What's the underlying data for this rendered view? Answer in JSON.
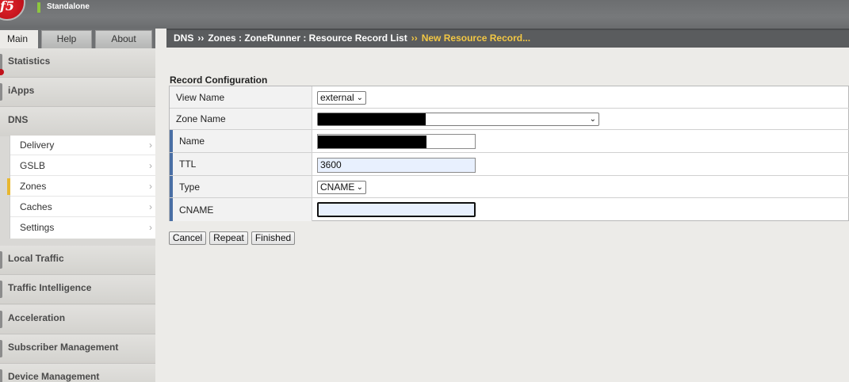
{
  "header": {
    "status": "Standalone",
    "logo_text": "f5"
  },
  "tabs": [
    {
      "label": "Main"
    },
    {
      "label": "Help"
    },
    {
      "label": "About"
    }
  ],
  "breadcrumb": {
    "items": [
      "DNS",
      "Zones : ZoneRunner : Resource Record List"
    ],
    "separator": "››",
    "current": "New Resource Record..."
  },
  "sidebar": {
    "sections": [
      {
        "label": "Statistics"
      },
      {
        "label": "iApps"
      },
      {
        "label": "DNS"
      },
      {
        "label": "Local Traffic"
      },
      {
        "label": "Traffic Intelligence"
      },
      {
        "label": "Acceleration"
      },
      {
        "label": "Subscriber Management"
      },
      {
        "label": "Device Management"
      }
    ],
    "dns_items": [
      {
        "label": "Delivery"
      },
      {
        "label": "GSLB"
      },
      {
        "label": "Zones",
        "selected": true
      },
      {
        "label": "Caches"
      },
      {
        "label": "Settings"
      }
    ],
    "chevron": "›"
  },
  "form": {
    "title": "Record Configuration",
    "rows": [
      {
        "label": "View Name",
        "value": "external"
      },
      {
        "label": "Zone Name",
        "value": ""
      },
      {
        "label": "Name",
        "value": ""
      },
      {
        "label": "TTL",
        "value": "3600"
      },
      {
        "label": "Type",
        "value": "CNAME"
      },
      {
        "label": "CNAME",
        "value": ""
      }
    ],
    "dropdown_arrow": "⌄"
  },
  "buttons": {
    "cancel": "Cancel",
    "repeat": "Repeat",
    "finished": "Finished"
  },
  "colors": {
    "accent_current": "#f2c744",
    "required_marker": "#4a6fa5",
    "selected_marker": "#e8b730",
    "logo_red": "#c1121b"
  }
}
